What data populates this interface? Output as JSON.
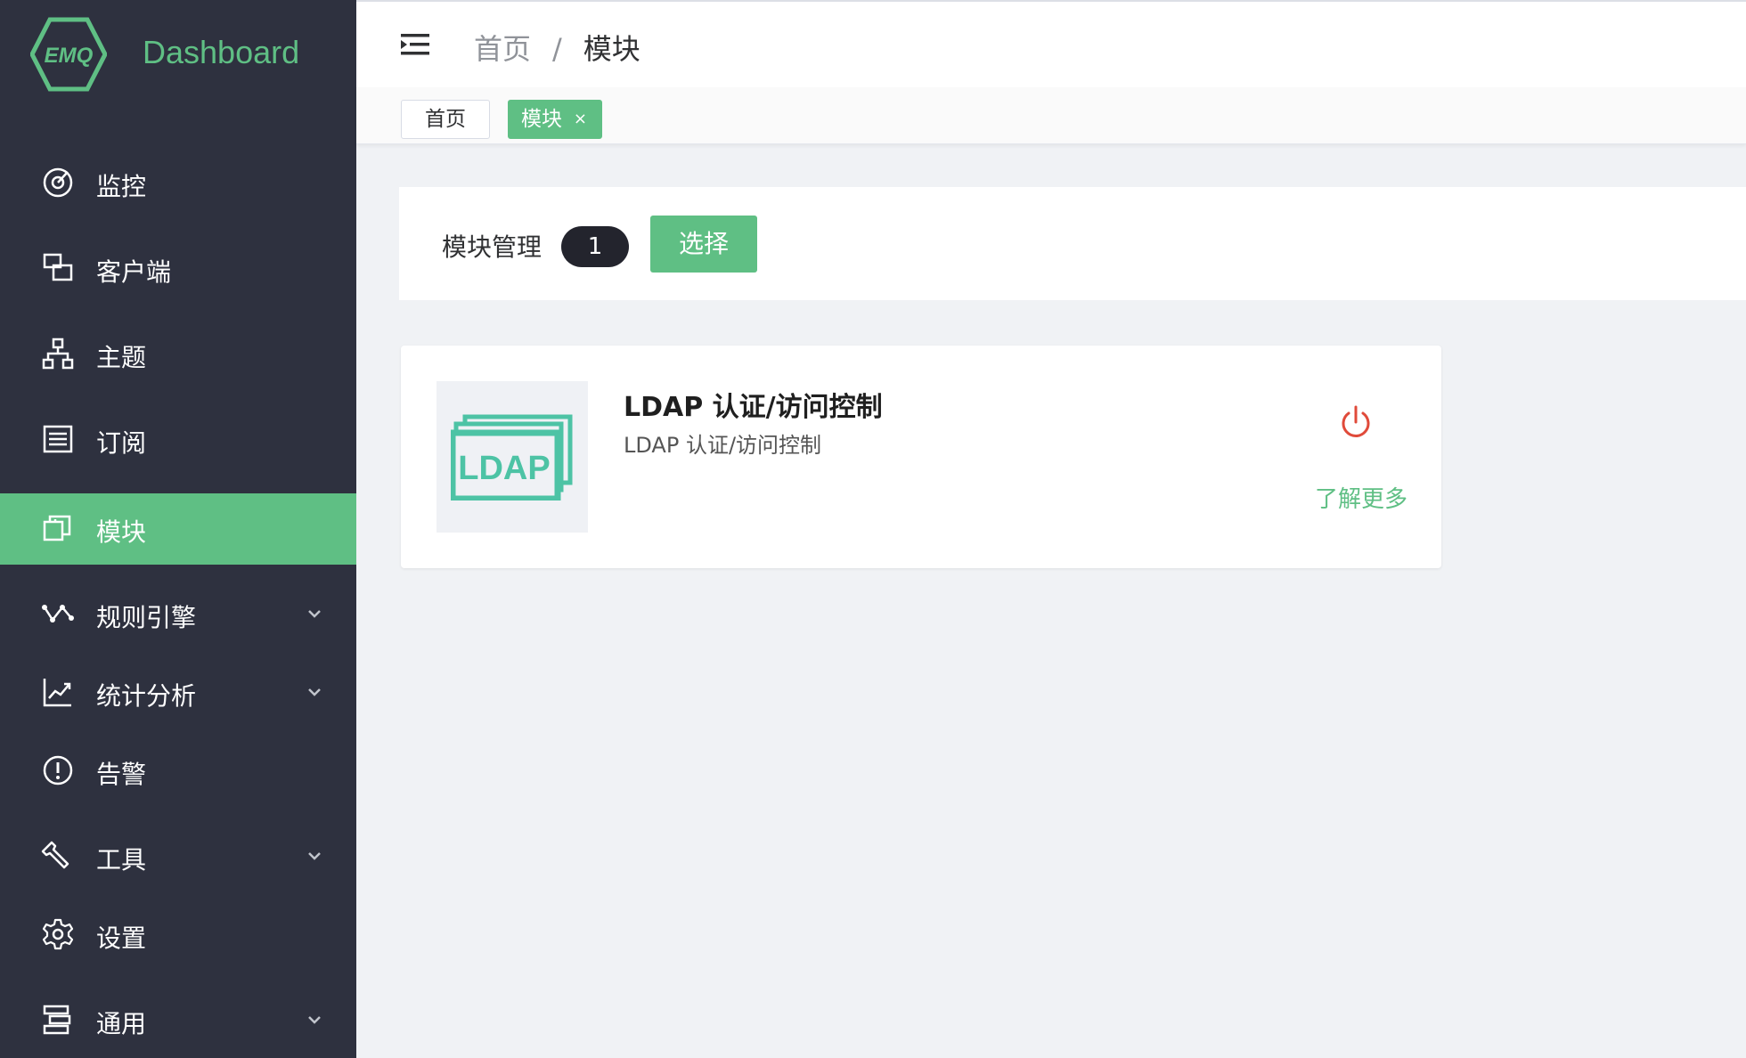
{
  "brand": {
    "name": "Dashboard",
    "logo_text": "EMQ",
    "accent": "#5fbf84",
    "sidebar_bg": "#2e313f"
  },
  "sidebar": {
    "items": [
      {
        "label": "监控",
        "icon": "monitor-gauge-icon",
        "active": false,
        "expandable": false
      },
      {
        "label": "客户端",
        "icon": "clients-icon",
        "active": false,
        "expandable": false
      },
      {
        "label": "主题",
        "icon": "topics-tree-icon",
        "active": false,
        "expandable": false
      },
      {
        "label": "订阅",
        "icon": "subscriptions-list-icon",
        "active": false,
        "expandable": false
      },
      {
        "label": "模块",
        "icon": "modules-icon",
        "active": true,
        "expandable": false
      },
      {
        "label": "规则引擎",
        "icon": "rule-engine-icon",
        "active": false,
        "expandable": true
      },
      {
        "label": "统计分析",
        "icon": "analytics-chart-icon",
        "active": false,
        "expandable": true
      },
      {
        "label": "告警",
        "icon": "alarm-exclamation-icon",
        "active": false,
        "expandable": false
      },
      {
        "label": "工具",
        "icon": "tools-wrench-icon",
        "active": false,
        "expandable": true
      },
      {
        "label": "设置",
        "icon": "settings-gear-icon",
        "active": false,
        "expandable": false
      },
      {
        "label": "通用",
        "icon": "general-icon",
        "active": false,
        "expandable": true
      }
    ]
  },
  "header": {
    "breadcrumb": {
      "home": "首页",
      "separator": "/",
      "current": "模块"
    }
  },
  "tags": {
    "home": "首页",
    "active": "模块",
    "close_symbol": "×"
  },
  "toolbar": {
    "label": "模块管理",
    "count": "1",
    "select_button": "选择"
  },
  "module": {
    "logo_text": "LDAP",
    "title": "LDAP 认证/访问控制",
    "description": "LDAP 认证/访问控制",
    "learn_more": "了解更多",
    "power_color": "#e04a3a"
  }
}
